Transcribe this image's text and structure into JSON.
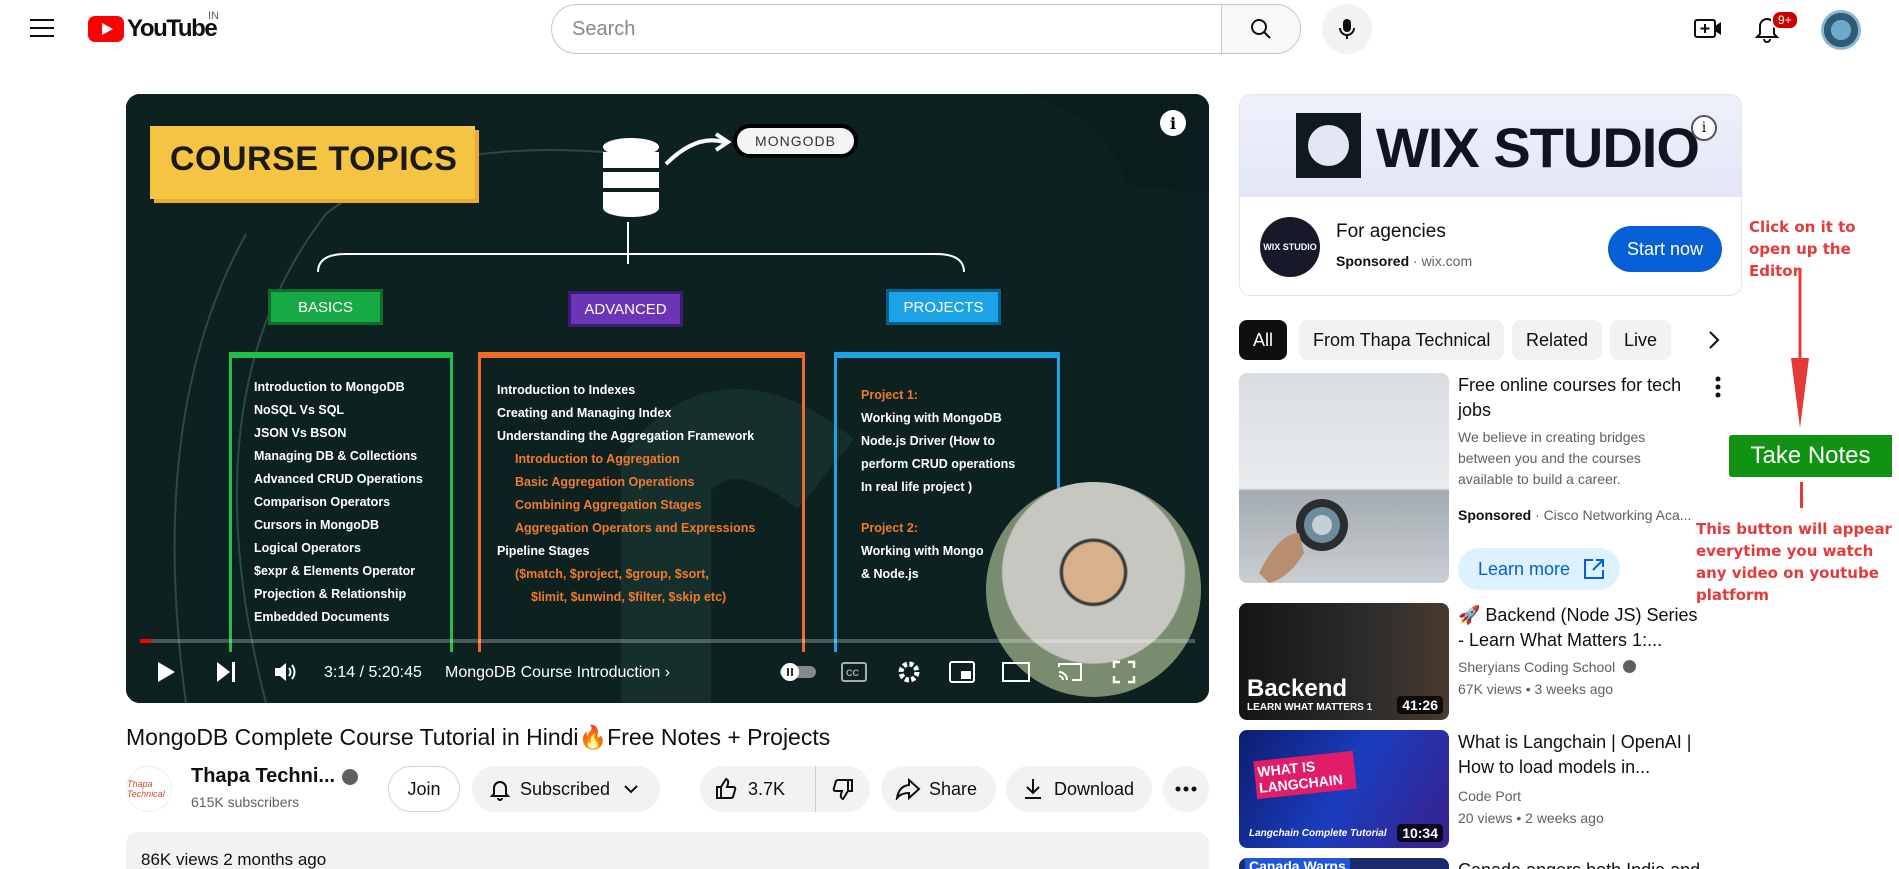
{
  "header": {
    "logo_text": "YouTube",
    "country": "IN",
    "search_placeholder": "Search",
    "notification_count": "9+"
  },
  "player": {
    "slide": {
      "heading": "COURSE TOPICS",
      "db_pill": "MONGODB",
      "tags": [
        "BASICS",
        "ADVANCED",
        "PROJECTS"
      ],
      "basics": [
        "Introduction to MongoDB",
        "NoSQL Vs SQL",
        "JSON Vs BSON",
        "Managing DB & Collections",
        "Advanced CRUD Operations",
        "Comparison Operators",
        "Cursors in MongoDB",
        "Logical Operators",
        "$expr & Elements Operator",
        "Projection & Relationship",
        "Embedded Documents"
      ],
      "advanced": [
        "Introduction to Indexes",
        "Creating and Managing Index",
        "Understanding the Aggregation Framework",
        "Introduction to Aggregation",
        "Basic Aggregation Operations",
        "Combining Aggregation Stages",
        "Aggregation Operators and Expressions",
        "Pipeline Stages",
        "($match, $project, $group, $sort,",
        "$limit, $unwind, $filter, $skip etc)"
      ],
      "projects": [
        "Project 1:",
        "Working with MongoDB",
        "Node.js Driver (How to",
        "perform CRUD operations",
        "In real life project )",
        "Project 2:",
        "Working with Mongo",
        "& Node.js"
      ]
    },
    "time": "3:14 / 5:20:45",
    "chapter": "MongoDB Course Introduction",
    "progress": 0.01
  },
  "video": {
    "title": "MongoDB Complete Course Tutorial in Hindi🔥Free Notes + Projects",
    "channel": "Thapa Techni...",
    "channel_logo": "Thapa Technical",
    "subscribers": "615K subscribers",
    "join": "Join",
    "subscribed": "Subscribed",
    "likes": "3.7K",
    "share": "Share",
    "download": "Download",
    "views_line": "86K views  2 months ago"
  },
  "ad": {
    "brand": "WIX STUDIO",
    "logo_text": "WIX STUDIO",
    "title": "For agencies",
    "sponsored": "Sponsored",
    "domain": "· wix.com",
    "cta": "Start now"
  },
  "chips": [
    "All",
    "From Thapa Technical",
    "Related",
    "Live"
  ],
  "related": [
    {
      "title": "Free online courses for tech jobs",
      "desc": "We believe in creating bridges between you and the courses available to build a career.",
      "sponsored": "Sponsored",
      "advertiser": "· Cisco Networking Aca...",
      "cta": "Learn more"
    },
    {
      "title": "🚀 Backend (Node JS) Series - Learn What Matters 1:...",
      "channel": "Sheryians Coding School",
      "meta": "67K views  • 3 weeks ago",
      "duration": "41:26",
      "thumb_text": "Backend",
      "thumb_sub": "LEARN WHAT MATTERS 1"
    },
    {
      "title": "What is Langchain | OpenAI | How to load models in...",
      "channel": "Code Port",
      "meta": "20 views  • 2 weeks ago",
      "duration": "10:34",
      "thumb_text": "WHAT IS LANGCHAIN",
      "thumb_sub": "Langchain Complete Tutorial"
    },
    {
      "title": "Canada angers both India and",
      "thumb_text": "Canada Warns"
    }
  ],
  "extension": {
    "note_top": "Click on it to open up the Editor",
    "button": "Take Notes",
    "note_bottom": "This button will appear everytime you watch any video on youtube platform"
  }
}
